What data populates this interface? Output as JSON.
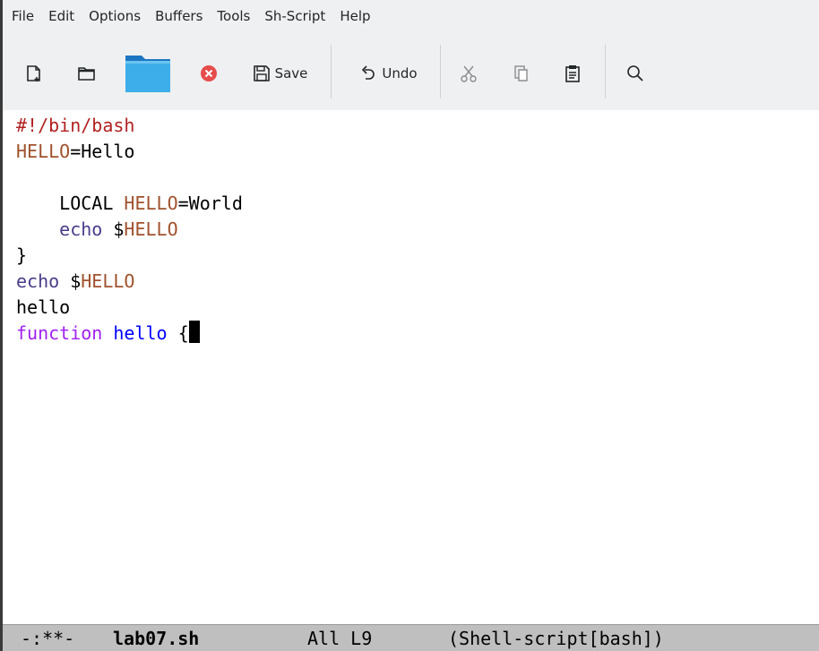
{
  "menubar": {
    "items": [
      "File",
      "Edit",
      "Options",
      "Buffers",
      "Tools",
      "Sh-Script",
      "Help"
    ]
  },
  "toolbar": {
    "new_file_icon": "new-file-icon",
    "open_icon": "folder-open-icon",
    "dired_icon": "folder-icon",
    "close_icon": "close-icon",
    "save_label": "Save",
    "undo_label": "Undo",
    "cut_icon": "cut-icon",
    "copy_icon": "copy-icon",
    "paste_icon": "paste-icon",
    "search_icon": "search-icon"
  },
  "editor": {
    "lines": [
      {
        "a": "#!/bin/bash"
      },
      {
        "a": "HELLO",
        "b": "=Hello"
      },
      {
        "a": ""
      },
      {
        "a": "    LOCAL ",
        "b": "HELLO",
        "c": "=World"
      },
      {
        "a": "    echo ",
        "b": "$",
        "c": "HELLO"
      },
      {
        "a": "}"
      },
      {
        "a": "echo ",
        "b": "$",
        "c": "HELLO"
      },
      {
        "a": "hello"
      },
      {
        "a": "function",
        "b": " ",
        "c": "hello",
        "d": " {"
      }
    ]
  },
  "colors": {
    "shebang": "#b22222",
    "variable": "#a0522d",
    "builtin": "#483d8b",
    "keyword": "#a020f0",
    "function_name": "#0000ff"
  },
  "modeline": {
    "status": "-:**-",
    "buffer": "lab07.sh",
    "position": "All L9",
    "mode": "(Shell-script[bash])"
  }
}
